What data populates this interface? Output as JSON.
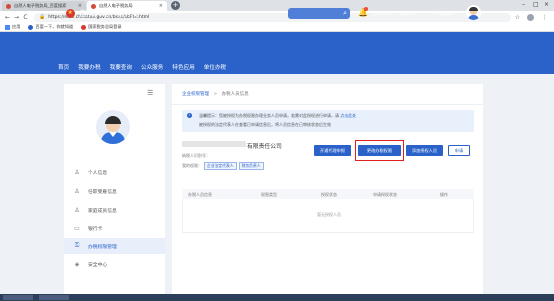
{
  "browser": {
    "tabs": [
      {
        "title": "自然人电子税务局_百度搜索"
      },
      {
        "title": "自然人电子税务局"
      }
    ],
    "url": "https://etax.chinatax.gov.cn/bsxx/sbPtrl.html",
    "bookmarks": [
      "应用",
      "百度一下，你就知道",
      "国家税务总局登录"
    ],
    "icons": {
      "back": "←",
      "forward": "→",
      "reload": "C",
      "star": "☆",
      "menu": "⋮",
      "new_tab": "+",
      "lock": "🔒"
    }
  },
  "site": {
    "title": "自然人电子税务局",
    "header_links": [
      "手机APP",
      "帮助中心",
      "下载服务"
    ],
    "nav": [
      "首页",
      "我要办税",
      "我要查询",
      "公众服务",
      "特色应用",
      "单位办税"
    ]
  },
  "sidebar": {
    "items": [
      {
        "label": "个人信息",
        "icon": "user-icon"
      },
      {
        "label": "任职受雇信息",
        "icon": "user-icon"
      },
      {
        "label": "家庭成员信息",
        "icon": "user-icon"
      },
      {
        "label": "银行卡",
        "icon": "card-icon"
      },
      {
        "label": "办税权限管理",
        "icon": "key-icon",
        "active": true
      },
      {
        "label": "安全中心",
        "icon": "shield-icon"
      }
    ]
  },
  "content": {
    "breadcrumb": {
      "parent": "企业权限管理",
      "sep": ">",
      "current": "办税人员信息"
    },
    "notice": {
      "line1": "温馨提示：您被授权为办税权限办理业务人员申请，若需对此授权进行申请，请",
      "link1": "点击此处",
      "line2": "被授权的法定代表人在查看已申请信息后，将人员信息在已审核状态后生效"
    },
    "company_suffix": "有限责任公司",
    "taxid_label": "纳税人识别号：",
    "roles_label": "我的权限：",
    "roles": [
      "企业法定代表人",
      "财务负责人"
    ],
    "buttons": {
      "open_agent": "开通代理申报",
      "change_role": "更改办税权限",
      "add_staff": "添加授权人员",
      "apply": "申请"
    },
    "table": {
      "columns": [
        "办税人员信息",
        "权限类型",
        "授权状态",
        "申请授权状态",
        "操作"
      ],
      "empty_text": "暂无授权人员"
    }
  }
}
